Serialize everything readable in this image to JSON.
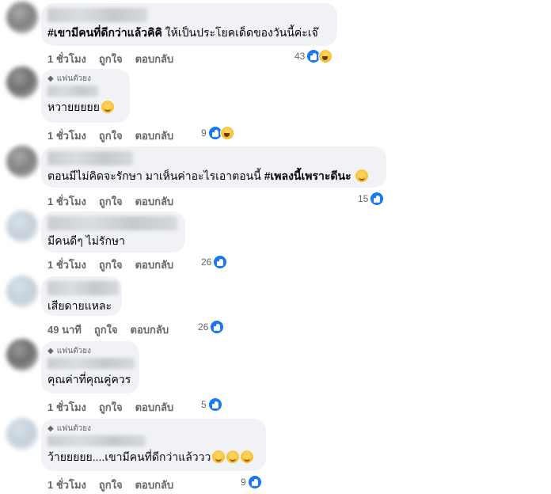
{
  "fan_badge_label": "แฟนตัวยง",
  "action_labels": {
    "like": "ถูกใจ",
    "reply": "ตอบกลับ"
  },
  "comments": [
    {
      "fan_badge": false,
      "text_bold": "#เขามีคนที่ดีกว่าแล้วคิคิ",
      "text": " ให้เป็นประโยคเด็ดของวันนี้ค่ะเจ๊",
      "time": "1 ชั่วโมง",
      "reaction_count": "43",
      "reactions": [
        "like",
        "haha"
      ]
    },
    {
      "fan_badge": true,
      "text": "หวายยยยย",
      "emoji": "face",
      "time": "1 ชั่วโมง",
      "reaction_count": "9",
      "reactions": [
        "like",
        "haha"
      ]
    },
    {
      "fan_badge": false,
      "text": "ตอนมีไม่คิดจะรักษา มาเห็นค่าอะไรเอาตอนนี้ ",
      "text_bold": "#เพลงนี้เพราะดีนะ",
      "emoji": "grin",
      "time": "1 ชั่วโมง",
      "reaction_count": "15",
      "reactions": [
        "like"
      ]
    },
    {
      "fan_badge": false,
      "text": "มีคนดีๆ ไม่รักษา",
      "time": "1 ชั่วโมง",
      "reaction_count": "26",
      "reactions": [
        "like"
      ]
    },
    {
      "fan_badge": false,
      "text": "เสียดายแหละ",
      "time": "49 นาที",
      "reaction_count": "26",
      "reactions": [
        "like"
      ]
    },
    {
      "fan_badge": true,
      "text": "คุณค่าที่คุณคู่ควร",
      "time": "1 ชั่วโมง",
      "reaction_count": "5",
      "reactions": [
        "like"
      ]
    },
    {
      "fan_badge": true,
      "text": "ว้ายยยยย....เขามีคนที่ดีกว่าแล้ววว",
      "emoji": "blush x3",
      "time": "1 ชั่วโมง",
      "reaction_count": "9",
      "reactions": [
        "like"
      ]
    }
  ]
}
